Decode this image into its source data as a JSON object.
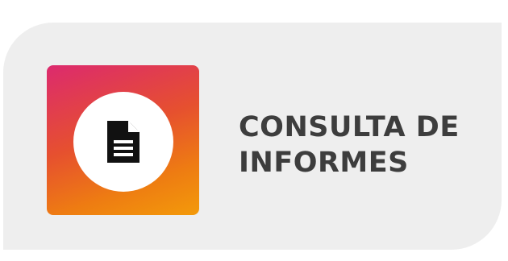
{
  "button": {
    "title_line1": "CONSULTA DE",
    "title_line2": "INFORMES",
    "icon": "document-icon",
    "colors": {
      "card_background": "#eeeeee",
      "gradient_start": "#dc2a6e",
      "gradient_end": "#f39a0a",
      "text": "#3d3d3d"
    }
  }
}
